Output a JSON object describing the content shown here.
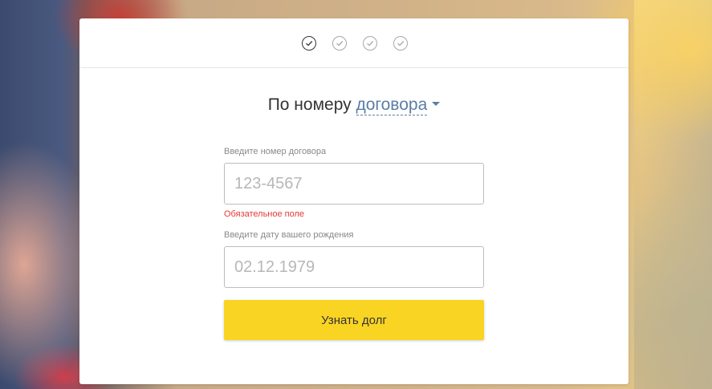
{
  "steps": [
    "check",
    "check",
    "check",
    "check"
  ],
  "heading": {
    "prefix": "По номеру",
    "dropdown_value": "договора"
  },
  "contract_field": {
    "label": "Введите номер договора",
    "placeholder": "123-4567",
    "error": "Обязательное поле"
  },
  "birthdate_field": {
    "label": "Введите дату вашего рождения",
    "placeholder": "02.12.1979"
  },
  "submit": {
    "label": "Узнать долг"
  },
  "colors": {
    "accent_button": "#f9d423",
    "link": "#5a7ea6",
    "error": "#e53935"
  }
}
